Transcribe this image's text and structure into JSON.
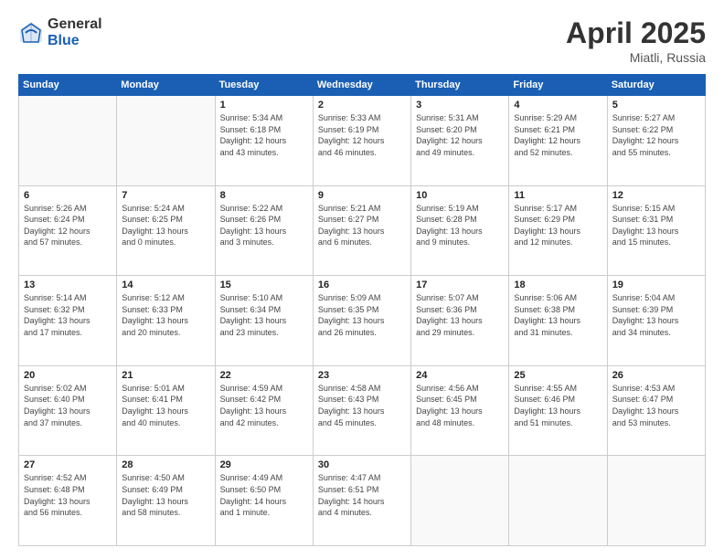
{
  "header": {
    "logo_general": "General",
    "logo_blue": "Blue",
    "month_title": "April 2025",
    "location": "Miatli, Russia"
  },
  "days_of_week": [
    "Sunday",
    "Monday",
    "Tuesday",
    "Wednesday",
    "Thursday",
    "Friday",
    "Saturday"
  ],
  "weeks": [
    [
      {
        "day": "",
        "info": ""
      },
      {
        "day": "",
        "info": ""
      },
      {
        "day": "1",
        "info": "Sunrise: 5:34 AM\nSunset: 6:18 PM\nDaylight: 12 hours\nand 43 minutes."
      },
      {
        "day": "2",
        "info": "Sunrise: 5:33 AM\nSunset: 6:19 PM\nDaylight: 12 hours\nand 46 minutes."
      },
      {
        "day": "3",
        "info": "Sunrise: 5:31 AM\nSunset: 6:20 PM\nDaylight: 12 hours\nand 49 minutes."
      },
      {
        "day": "4",
        "info": "Sunrise: 5:29 AM\nSunset: 6:21 PM\nDaylight: 12 hours\nand 52 minutes."
      },
      {
        "day": "5",
        "info": "Sunrise: 5:27 AM\nSunset: 6:22 PM\nDaylight: 12 hours\nand 55 minutes."
      }
    ],
    [
      {
        "day": "6",
        "info": "Sunrise: 5:26 AM\nSunset: 6:24 PM\nDaylight: 12 hours\nand 57 minutes."
      },
      {
        "day": "7",
        "info": "Sunrise: 5:24 AM\nSunset: 6:25 PM\nDaylight: 13 hours\nand 0 minutes."
      },
      {
        "day": "8",
        "info": "Sunrise: 5:22 AM\nSunset: 6:26 PM\nDaylight: 13 hours\nand 3 minutes."
      },
      {
        "day": "9",
        "info": "Sunrise: 5:21 AM\nSunset: 6:27 PM\nDaylight: 13 hours\nand 6 minutes."
      },
      {
        "day": "10",
        "info": "Sunrise: 5:19 AM\nSunset: 6:28 PM\nDaylight: 13 hours\nand 9 minutes."
      },
      {
        "day": "11",
        "info": "Sunrise: 5:17 AM\nSunset: 6:29 PM\nDaylight: 13 hours\nand 12 minutes."
      },
      {
        "day": "12",
        "info": "Sunrise: 5:15 AM\nSunset: 6:31 PM\nDaylight: 13 hours\nand 15 minutes."
      }
    ],
    [
      {
        "day": "13",
        "info": "Sunrise: 5:14 AM\nSunset: 6:32 PM\nDaylight: 13 hours\nand 17 minutes."
      },
      {
        "day": "14",
        "info": "Sunrise: 5:12 AM\nSunset: 6:33 PM\nDaylight: 13 hours\nand 20 minutes."
      },
      {
        "day": "15",
        "info": "Sunrise: 5:10 AM\nSunset: 6:34 PM\nDaylight: 13 hours\nand 23 minutes."
      },
      {
        "day": "16",
        "info": "Sunrise: 5:09 AM\nSunset: 6:35 PM\nDaylight: 13 hours\nand 26 minutes."
      },
      {
        "day": "17",
        "info": "Sunrise: 5:07 AM\nSunset: 6:36 PM\nDaylight: 13 hours\nand 29 minutes."
      },
      {
        "day": "18",
        "info": "Sunrise: 5:06 AM\nSunset: 6:38 PM\nDaylight: 13 hours\nand 31 minutes."
      },
      {
        "day": "19",
        "info": "Sunrise: 5:04 AM\nSunset: 6:39 PM\nDaylight: 13 hours\nand 34 minutes."
      }
    ],
    [
      {
        "day": "20",
        "info": "Sunrise: 5:02 AM\nSunset: 6:40 PM\nDaylight: 13 hours\nand 37 minutes."
      },
      {
        "day": "21",
        "info": "Sunrise: 5:01 AM\nSunset: 6:41 PM\nDaylight: 13 hours\nand 40 minutes."
      },
      {
        "day": "22",
        "info": "Sunrise: 4:59 AM\nSunset: 6:42 PM\nDaylight: 13 hours\nand 42 minutes."
      },
      {
        "day": "23",
        "info": "Sunrise: 4:58 AM\nSunset: 6:43 PM\nDaylight: 13 hours\nand 45 minutes."
      },
      {
        "day": "24",
        "info": "Sunrise: 4:56 AM\nSunset: 6:45 PM\nDaylight: 13 hours\nand 48 minutes."
      },
      {
        "day": "25",
        "info": "Sunrise: 4:55 AM\nSunset: 6:46 PM\nDaylight: 13 hours\nand 51 minutes."
      },
      {
        "day": "26",
        "info": "Sunrise: 4:53 AM\nSunset: 6:47 PM\nDaylight: 13 hours\nand 53 minutes."
      }
    ],
    [
      {
        "day": "27",
        "info": "Sunrise: 4:52 AM\nSunset: 6:48 PM\nDaylight: 13 hours\nand 56 minutes."
      },
      {
        "day": "28",
        "info": "Sunrise: 4:50 AM\nSunset: 6:49 PM\nDaylight: 13 hours\nand 58 minutes."
      },
      {
        "day": "29",
        "info": "Sunrise: 4:49 AM\nSunset: 6:50 PM\nDaylight: 14 hours\nand 1 minute."
      },
      {
        "day": "30",
        "info": "Sunrise: 4:47 AM\nSunset: 6:51 PM\nDaylight: 14 hours\nand 4 minutes."
      },
      {
        "day": "",
        "info": ""
      },
      {
        "day": "",
        "info": ""
      },
      {
        "day": "",
        "info": ""
      }
    ]
  ]
}
